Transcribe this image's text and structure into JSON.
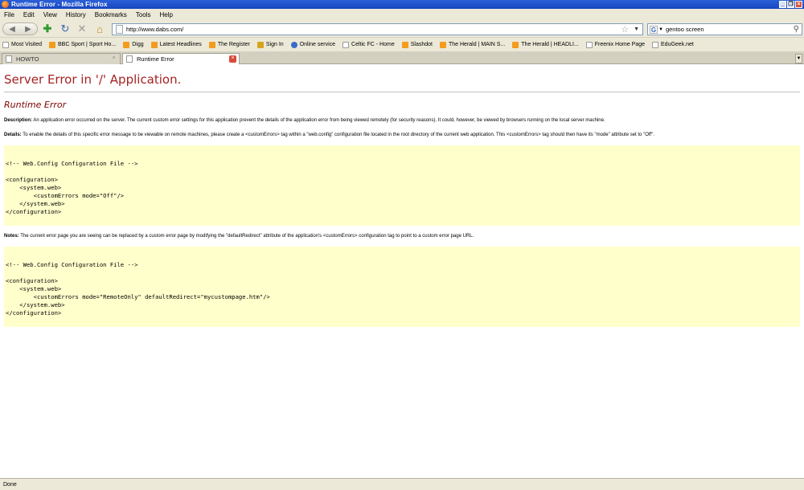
{
  "window": {
    "title": "Runtime Error - Mozilla Firefox"
  },
  "menu": [
    "File",
    "Edit",
    "View",
    "History",
    "Bookmarks",
    "Tools",
    "Help"
  ],
  "toolbar": {
    "url": "http://www.dabs.com/",
    "search_value": "gentoo screen"
  },
  "bookmarks": [
    {
      "label": "Most Visited",
      "icon": "page"
    },
    {
      "label": "BBC Sport | Sport Ho...",
      "icon": "rss"
    },
    {
      "label": "Digg",
      "icon": "rss"
    },
    {
      "label": "Latest Headlines",
      "icon": "rss"
    },
    {
      "label": "The Register",
      "icon": "rss"
    },
    {
      "label": "Sign In",
      "icon": "gold"
    },
    {
      "label": "Online service",
      "icon": "blue"
    },
    {
      "label": "Celtic FC - Home",
      "icon": "page"
    },
    {
      "label": "Slashdot",
      "icon": "rss"
    },
    {
      "label": "The Herald | MAIN S...",
      "icon": "rss"
    },
    {
      "label": "The Herald | HEADLI...",
      "icon": "rss"
    },
    {
      "label": "Freenix Home Page",
      "icon": "page"
    },
    {
      "label": "EduGeek.net",
      "icon": "page"
    }
  ],
  "tabs": [
    {
      "label": "HOWTO",
      "active": false
    },
    {
      "label": "Runtime Error",
      "active": true
    }
  ],
  "page": {
    "heading": "Server Error in '/' Application.",
    "subheading": "Runtime Error",
    "description_label": "Description:",
    "description_text": " An application error occurred on the server. The current custom error settings for this application prevent the details of the application error from being viewed remotely (for security reasons). It could, however, be viewed by browsers running on the local server machine.",
    "details_label": "Details:",
    "details_text": " To enable the details of this specific error message to be viewable on remote machines, please create a <customErrors> tag within a \"web.config\" configuration file located in the root directory of the current web application. This <customErrors> tag should then have its \"mode\" attribute set to \"Off\".",
    "code1": "<!-- Web.Config Configuration File -->\n\n<configuration>\n    <system.web>\n        <customErrors mode=\"Off\"/>\n    </system.web>\n</configuration>",
    "notes_label": "Notes:",
    "notes_text": " The current error page you are seeing can be replaced by a custom error page by modifying the \"defaultRedirect\" attribute of the application's <customErrors> configuration tag to point to a custom error page URL.",
    "code2": "<!-- Web.Config Configuration File -->\n\n<configuration>\n    <system.web>\n        <customErrors mode=\"RemoteOnly\" defaultRedirect=\"mycustompage.htm\"/>\n    </system.web>\n</configuration>"
  },
  "status": {
    "text": "Done"
  },
  "colors": {
    "heading": "#a62222",
    "subheading": "#800000",
    "code_bg": "#ffffcc"
  }
}
